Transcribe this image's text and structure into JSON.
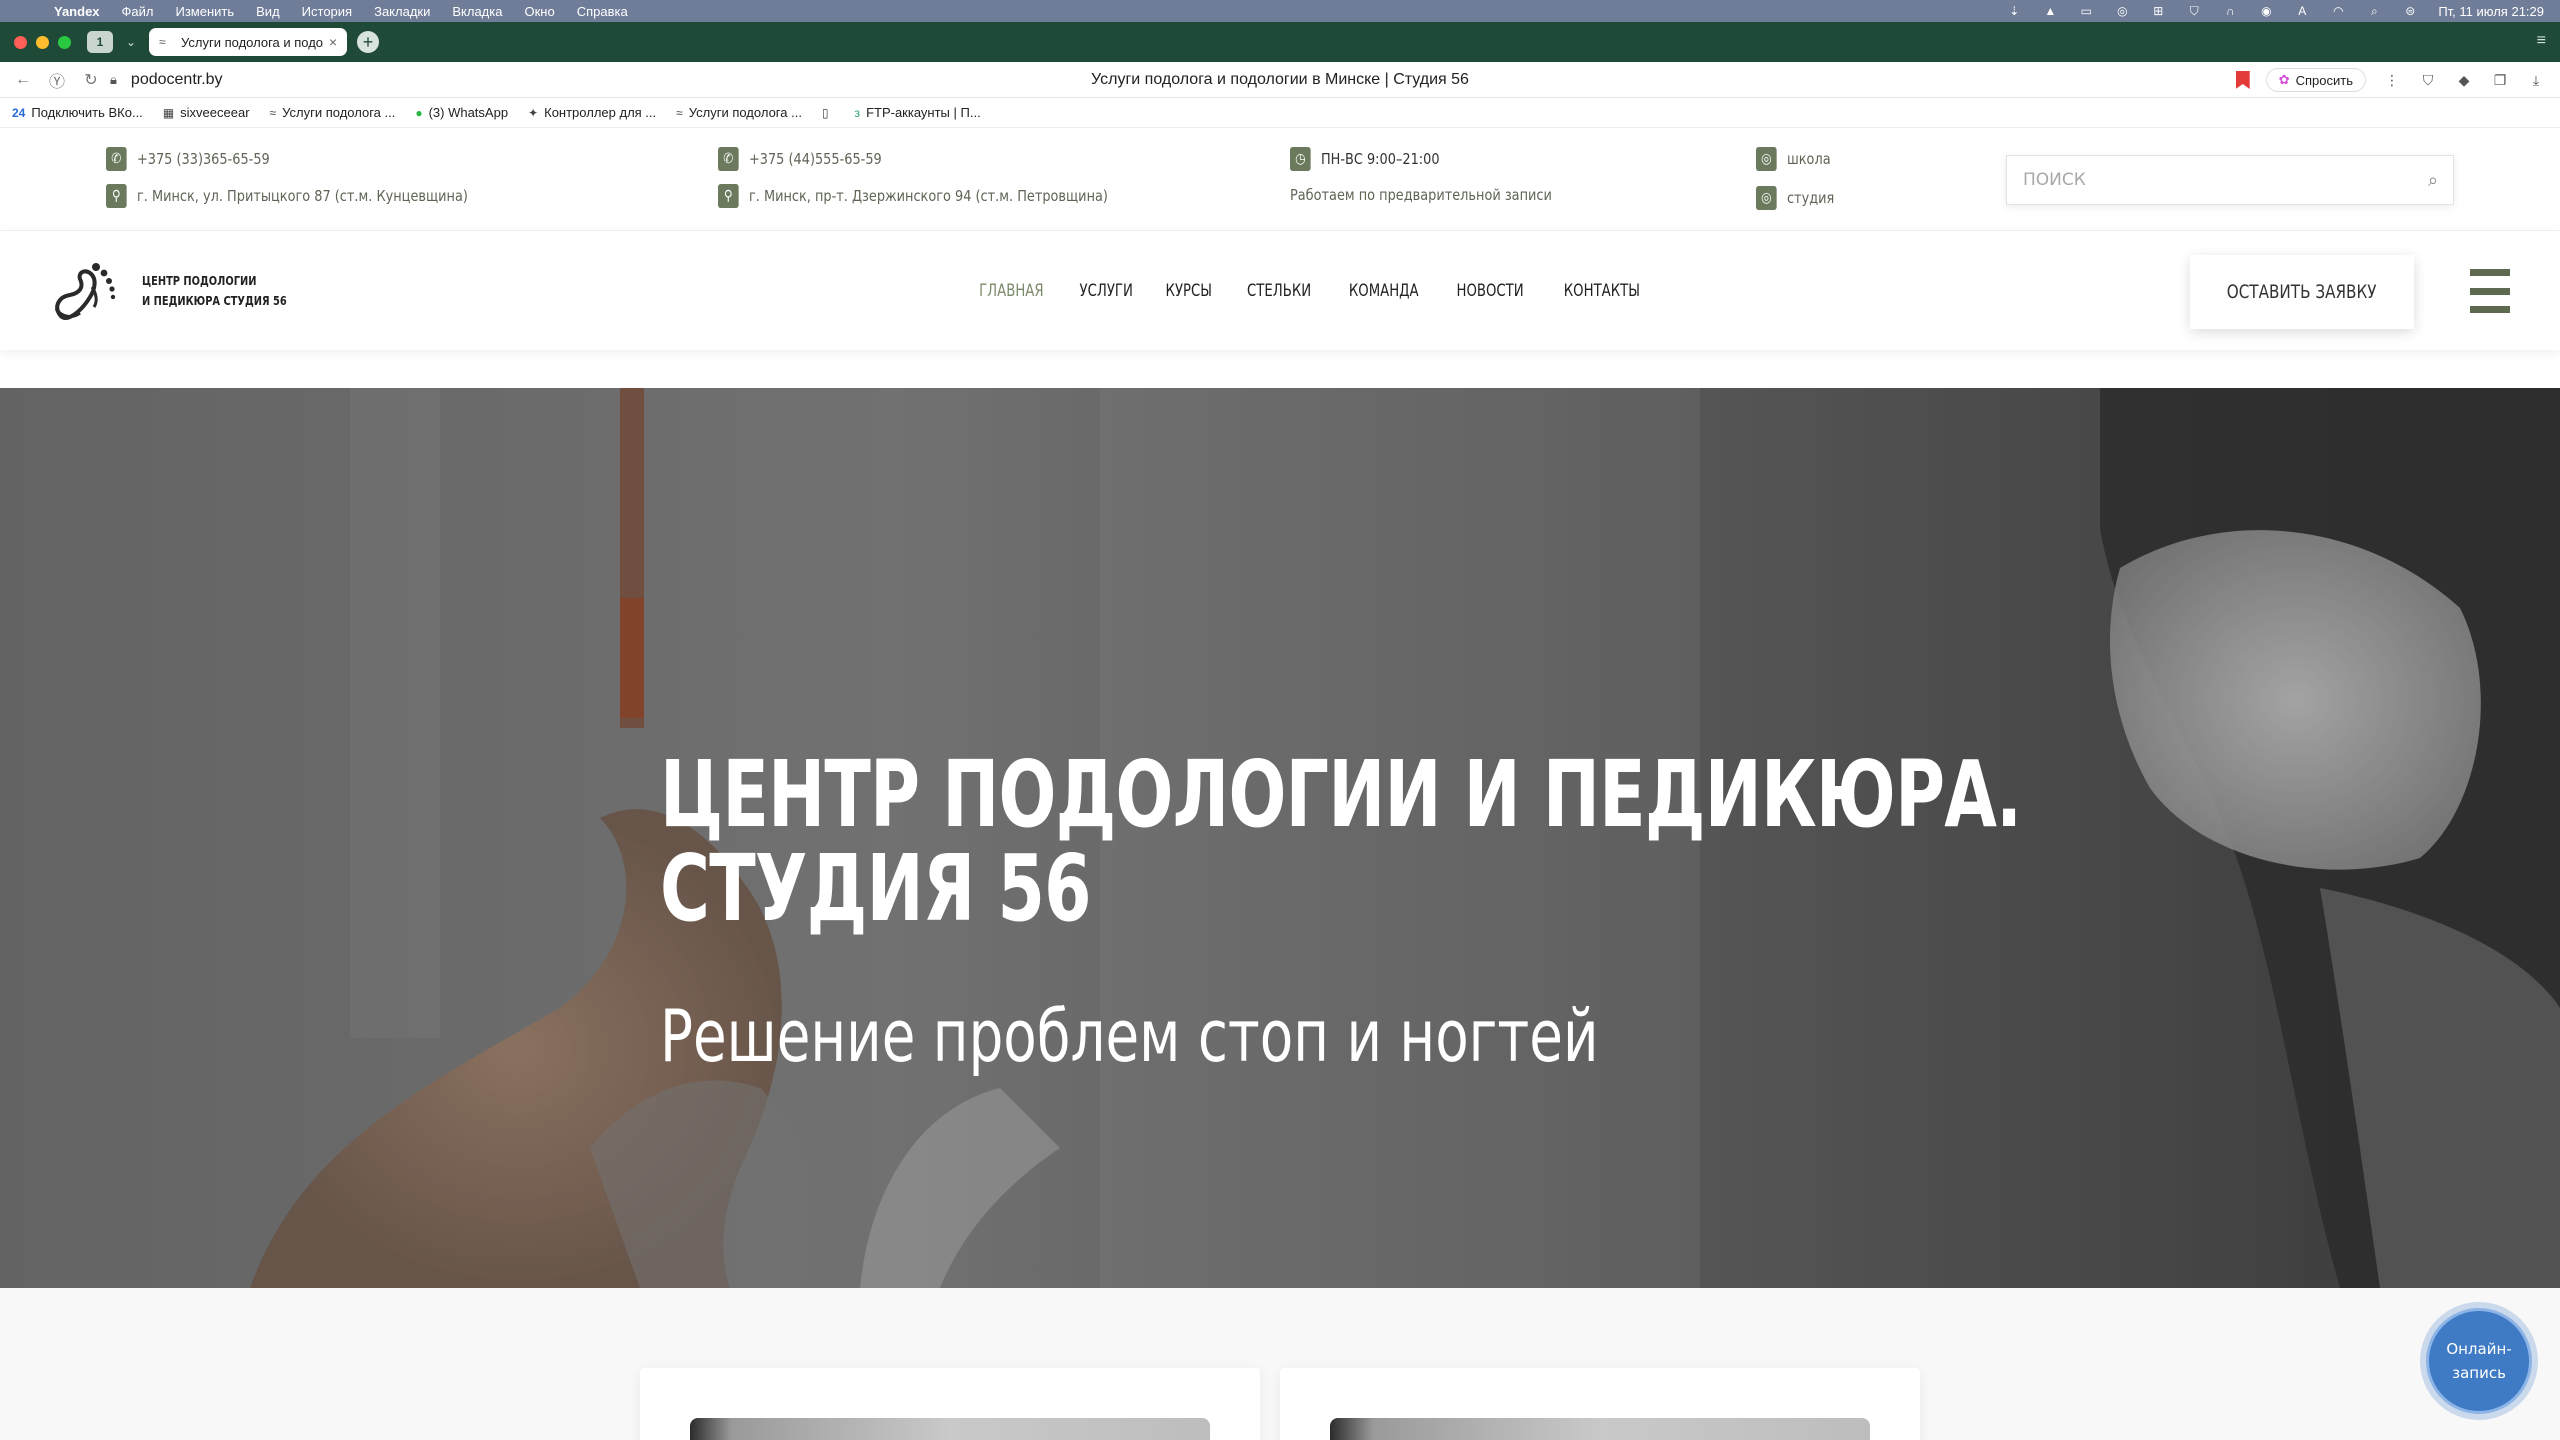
{
  "mac_menubar": {
    "app_name": "Yandex",
    "items": [
      "Файл",
      "Изменить",
      "Вид",
      "История",
      "Закладки",
      "Вкладка",
      "Окно",
      "Справка"
    ],
    "clock": "Пт, 11 июля  21:29"
  },
  "browser": {
    "tab_count": "1",
    "active_tab_title": "Услуги подолога и подолог",
    "url_host": "podocentr.by",
    "page_title": "Услуги подолога и подологии в Минске | Студия 56",
    "ask_button": "Спросить",
    "bookmarks": [
      {
        "icon": "vk-icon",
        "glyph": "24",
        "label": "Подключить ВКо..."
      },
      {
        "icon": "site-icon",
        "glyph": "▦",
        "label": "sixveeceear"
      },
      {
        "icon": "foot-icon",
        "glyph": "≈",
        "label": "Услуги подолога ..."
      },
      {
        "icon": "whatsapp-icon",
        "glyph": "●",
        "label": "(3) WhatsApp"
      },
      {
        "icon": "controller-icon",
        "glyph": "✦",
        "label": "Контроллер для ..."
      },
      {
        "icon": "foot-icon",
        "glyph": "≈",
        "label": "Услуги подолога ..."
      },
      {
        "icon": "page-icon",
        "glyph": "▯",
        "label": ""
      },
      {
        "icon": "ftp-icon",
        "glyph": "з",
        "label": "FTP-аккаунты | П..."
      }
    ]
  },
  "info_strip": {
    "phone1": "+375 (33)365-65-59",
    "address1": "г. Минск, ул. Притыцкого 87 (ст.м. Кунцевщина)",
    "phone2": "+375 (44)555-65-59",
    "address2": "г. Минск, пр-т. Дзержинского 94 (ст.м. Петровщина)",
    "hours": "ПН-ВС 9:00–21:00",
    "hours_note": "Работаем по предварительной записи",
    "instagram_school": "школа",
    "instagram_studio": "студия",
    "search_placeholder": "ПОИСК"
  },
  "header": {
    "logo_line1": "ЦЕНТР ПОДОЛОГИИ",
    "logo_line2": "И ПЕДИКЮРА СТУДИЯ 56",
    "nav": [
      "ГЛАВНАЯ",
      "УСЛУГИ",
      "КУРСЫ",
      "СТЕЛЬКИ",
      "КОМАНДА",
      "НОВОСТИ",
      "КОНТАКТЫ"
    ],
    "active_nav": "ГЛАВНАЯ",
    "cta": "ОСТАВИТЬ ЗАЯВКУ"
  },
  "hero": {
    "title_line1": "ЦЕНТР ПОДОЛОГИИ И ПЕДИКЮРА.",
    "title_line2": "СТУДИЯ 56",
    "subtitle": "Решение проблем стоп и ногтей"
  },
  "floating": {
    "online_line1": "Онлайн-",
    "online_line2": "запись"
  },
  "colors": {
    "brand_olive": "#6b7a5c",
    "tabbar_green": "#1f4a37",
    "menubar": "#6f7d99",
    "online_blue": "#3f7bc4"
  }
}
